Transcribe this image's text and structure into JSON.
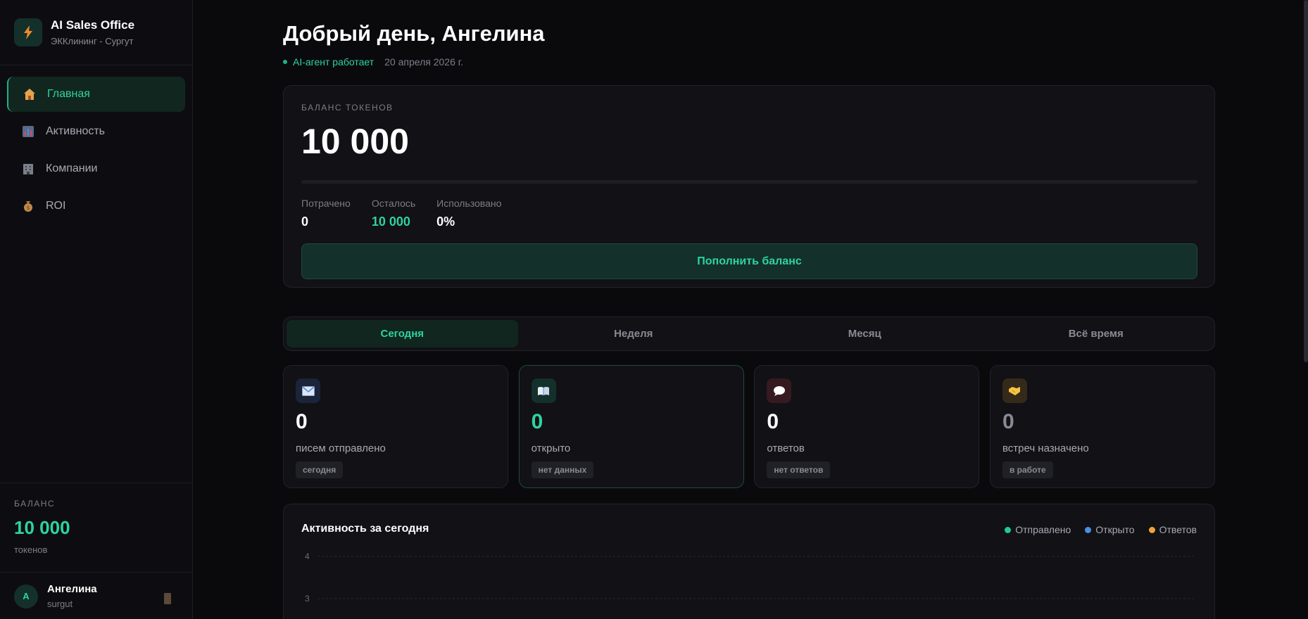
{
  "brand": {
    "title": "AI Sales Office",
    "subtitle": "ЭККлининг - Сургут"
  },
  "nav": [
    {
      "label": "Главная",
      "icon": "house-icon"
    },
    {
      "label": "Активность",
      "icon": "bar-chart-icon"
    },
    {
      "label": "Компании",
      "icon": "office-building-icon"
    },
    {
      "label": "ROI",
      "icon": "money-bag-icon"
    }
  ],
  "sidebar_balance": {
    "label": "БАЛАНС",
    "value": "10 000",
    "unit": "токенов"
  },
  "user": {
    "avatar": "А",
    "name": "Ангелина",
    "login": "surgut"
  },
  "header": {
    "greeting": "Добрый день, Ангелина",
    "agent_status": "AI-агент работает",
    "date": "20 апреля 2026 г."
  },
  "balance": {
    "label": "БАЛАНС ТОКЕНОВ",
    "value": "10 000",
    "used_fraction": 0,
    "stats": [
      {
        "label": "Потрачено",
        "value": "0",
        "accent": false
      },
      {
        "label": "Осталось",
        "value": "10 000",
        "accent": true
      },
      {
        "label": "Использовано",
        "value": "0%",
        "accent": false
      }
    ],
    "topup_label": "Пополнить баланс"
  },
  "tabs": [
    {
      "label": "Сегодня",
      "active": true
    },
    {
      "label": "Неделя",
      "active": false
    },
    {
      "label": "Месяц",
      "active": false
    },
    {
      "label": "Всё время",
      "active": false
    }
  ],
  "metrics": [
    {
      "value": "0",
      "label": "писем отправлено",
      "badge": "сегодня",
      "icon": "envelope-icon"
    },
    {
      "value": "0",
      "label": "открыто",
      "badge": "нет данных",
      "icon": "open-book-icon"
    },
    {
      "value": "0",
      "label": "ответов",
      "badge": "нет ответов",
      "icon": "speech-bubble-icon"
    },
    {
      "value": "0",
      "label": "встреч назначено",
      "badge": "в работе",
      "icon": "handshake-icon"
    }
  ],
  "chart": {
    "title": "Активность за сегодня",
    "legend": [
      {
        "name": "Отправлено",
        "color": "#1fc99a"
      },
      {
        "name": "Открыто",
        "color": "#4a8fe0"
      },
      {
        "name": "Ответов",
        "color": "#f0a23a"
      }
    ]
  },
  "chart_data": {
    "type": "line",
    "title": "Активность за сегодня",
    "y_ticks": [
      4,
      3
    ],
    "ylim": [
      0,
      4
    ],
    "grid": true,
    "legend_position": "top-right",
    "series": [
      {
        "name": "Отправлено",
        "values": []
      },
      {
        "name": "Открыто",
        "values": []
      },
      {
        "name": "Ответов",
        "values": []
      }
    ]
  },
  "colors": {
    "accent": "#2ed3a0",
    "background": "#0a0a0d",
    "card": "#111116"
  }
}
